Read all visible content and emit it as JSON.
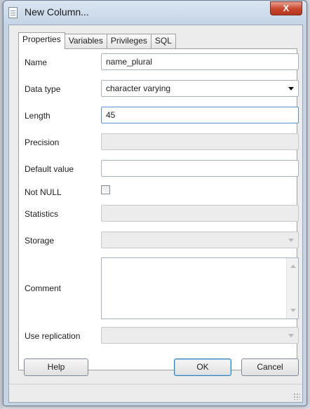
{
  "window": {
    "title": "New Column...",
    "close_glyph": "X"
  },
  "tabs": [
    {
      "label": "Properties",
      "active": true
    },
    {
      "label": "Variables",
      "active": false
    },
    {
      "label": "Privileges",
      "active": false
    },
    {
      "label": "SQL",
      "active": false
    }
  ],
  "form": {
    "name_label": "Name",
    "name_value": "name_plural",
    "datatype_label": "Data type",
    "datatype_value": "character varying",
    "length_label": "Length",
    "length_value": "45",
    "precision_label": "Precision",
    "precision_value": "",
    "default_label": "Default value",
    "default_value": "",
    "notnull_label": "Not NULL",
    "notnull_checked": false,
    "statistics_label": "Statistics",
    "statistics_value": "",
    "storage_label": "Storage",
    "storage_value": "",
    "comment_label": "Comment",
    "comment_value": "",
    "replication_label": "Use replication",
    "replication_value": ""
  },
  "buttons": {
    "help": "Help",
    "ok": "OK",
    "cancel": "Cancel"
  },
  "icons": {
    "title": "document-icon",
    "close": "close-icon",
    "dropdown": "chevron-down-icon",
    "resize": "resize-grip-icon"
  }
}
